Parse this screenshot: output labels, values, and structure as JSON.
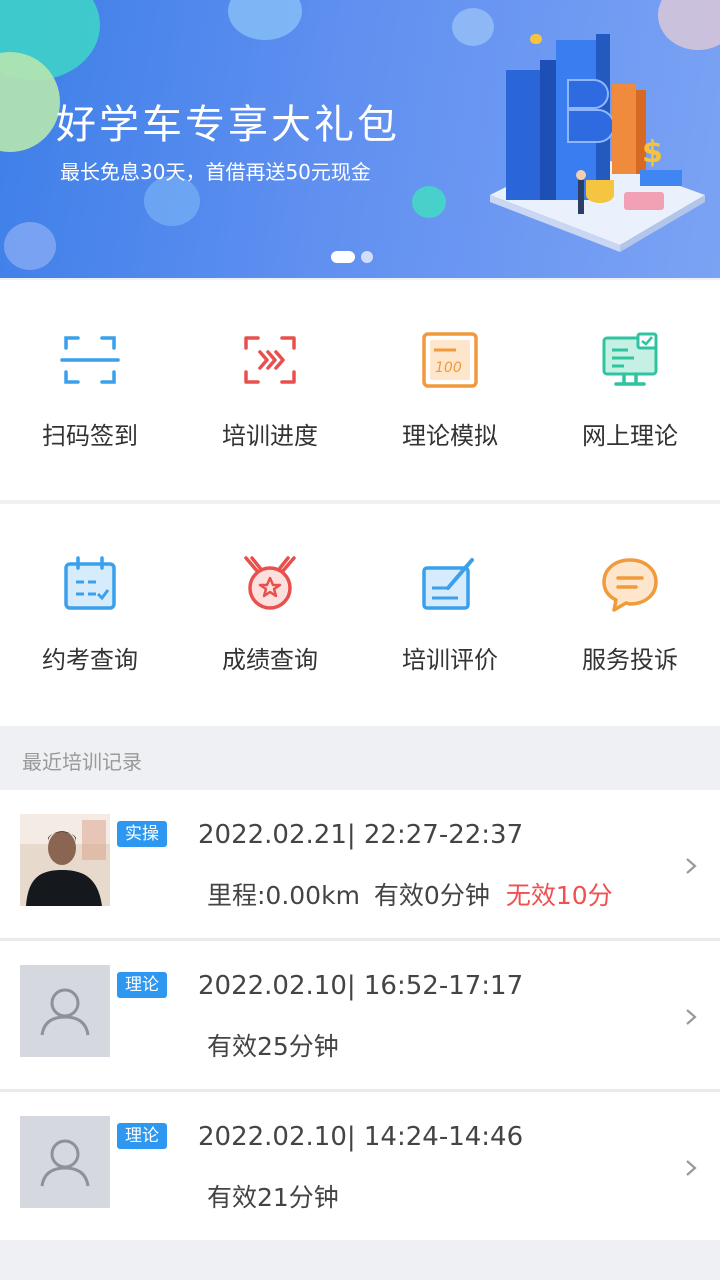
{
  "banner": {
    "title": "好学车专享大礼包",
    "subtitle": "最长免息30天，首借再送50元现金",
    "dots": 2,
    "active_dot": 0
  },
  "grid_row1": [
    {
      "label": "扫码签到",
      "icon": "scan-icon"
    },
    {
      "label": "培训进度",
      "icon": "progress-icon"
    },
    {
      "label": "理论模拟",
      "icon": "exam-paper-icon"
    },
    {
      "label": "网上理论",
      "icon": "monitor-icon"
    }
  ],
  "grid_row2": [
    {
      "label": "约考查询",
      "icon": "calendar-icon"
    },
    {
      "label": "成绩查询",
      "icon": "medal-icon"
    },
    {
      "label": "培训评价",
      "icon": "edit-icon"
    },
    {
      "label": "服务投诉",
      "icon": "chat-icon"
    }
  ],
  "recent": {
    "header": "最近培训记录",
    "records": [
      {
        "tag": "实操",
        "time": "2022.02.21| 22:27-22:37",
        "mileage": "里程:0.00km",
        "valid": "有效0分钟",
        "invalid": "无效10分",
        "photo": "student-photo"
      },
      {
        "tag": "理论",
        "time": "2022.02.10| 16:52-17:17",
        "valid": "有效25分钟",
        "photo": "avatar-placeholder"
      },
      {
        "tag": "理论",
        "time": "2022.02.10| 14:24-14:46",
        "valid": "有效21分钟",
        "photo": "avatar-placeholder"
      }
    ]
  },
  "colors": {
    "accent": "#2e97f0",
    "invalid": "#f05050",
    "banner": "#4a86ec"
  }
}
